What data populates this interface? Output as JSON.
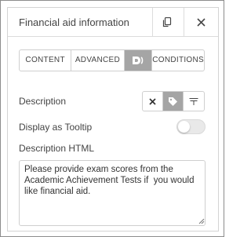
{
  "header": {
    "title": "Financial aid information",
    "copy_icon": "copy-icon",
    "close_icon": "close-icon"
  },
  "tabs": [
    {
      "label": "CONTENT"
    },
    {
      "label": "ADVANCED"
    },
    {
      "label": "",
      "icon": "dynamic-tag-icon",
      "active": true
    },
    {
      "label": "CONDITIONS"
    }
  ],
  "description": {
    "label": "Description",
    "options": [
      {
        "icon": "none-icon"
      },
      {
        "icon": "tag-icon",
        "active": true
      },
      {
        "icon": "tooltip-icon"
      }
    ]
  },
  "tooltip": {
    "label": "Display as Tooltip",
    "enabled": false
  },
  "description_html": {
    "label": "Description HTML",
    "value": "Please provide exam scores from the Academic Achievement Tests if  you would like financial aid."
  },
  "colors": {
    "active_bg": "#a5a5a5",
    "border": "#cfcfcf",
    "text": "#444444"
  }
}
